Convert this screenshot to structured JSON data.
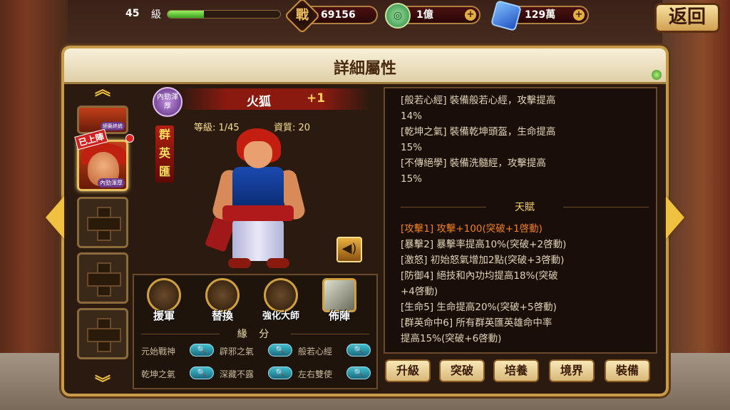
{
  "topbar": {
    "level_value": "45",
    "level_label": "級",
    "exp_fraction": 0.32,
    "power": {
      "icon": "power-icon",
      "glyph": "戰",
      "value": "69156"
    },
    "coins": {
      "icon": "coin-icon",
      "value": "1億"
    },
    "gems": {
      "icon": "gem-icon",
      "value": "129萬"
    },
    "back_label": "返回"
  },
  "panel": {
    "title": "詳細屬性"
  },
  "hero_slots": {
    "deploy_tag": "已上陣",
    "slot_tag": "內勁渾厚",
    "slot_tag_top": "絕藝終統"
  },
  "hero": {
    "name": "火狐",
    "plus": "+1",
    "type_badge": "內勁渾厚",
    "faction": "群英匯",
    "level": "等級: 1/45",
    "aptitude": "資質: 20"
  },
  "actions": [
    {
      "label": "援軍"
    },
    {
      "label": "替換"
    },
    {
      "label": "強化大師"
    },
    {
      "label": "佈陣"
    }
  ],
  "fate": {
    "title": "緣 分",
    "items": [
      {
        "name": "元始戰神"
      },
      {
        "name": "辟邪之氣"
      },
      {
        "name": "般若心經"
      },
      {
        "name": "乾坤之氣"
      },
      {
        "name": "深藏不露"
      },
      {
        "name": "左右雙使"
      }
    ]
  },
  "info": {
    "lines": [
      "[般若心經] 裝備般若心經，攻擊提高",
      "14%",
      "[乾坤之氣] 裝備乾坤頭盔，生命提高",
      "15%",
      "[不傳絕學] 裝備洗髓經，攻擊提高",
      "15%"
    ],
    "talent_title": "天賦",
    "talents": [
      "[攻擊1] 攻擊+100(突破+1啓動)",
      "[暴擊2] 暴擊率提高10%(突破+2啓動)",
      "[激怒] 初始怒氣增加2點(突破+3啓動)",
      "[防御4] 絕技和內功均提高18%(突破",
      "+4啓動)",
      "[生命5] 生命提高20%(突破+5啓動)",
      "[群英命中6] 所有群英匯英雄命中率",
      "提高15%(突破+6啓動)"
    ]
  },
  "buttons": [
    {
      "label": "升級"
    },
    {
      "label": "突破"
    },
    {
      "label": "培養"
    },
    {
      "label": "境界"
    },
    {
      "label": "裝備"
    }
  ],
  "colors": {
    "accent_gold": "#c89a4a",
    "highlight_orange": "#f08020",
    "panel_bg": "#2a1a10"
  }
}
